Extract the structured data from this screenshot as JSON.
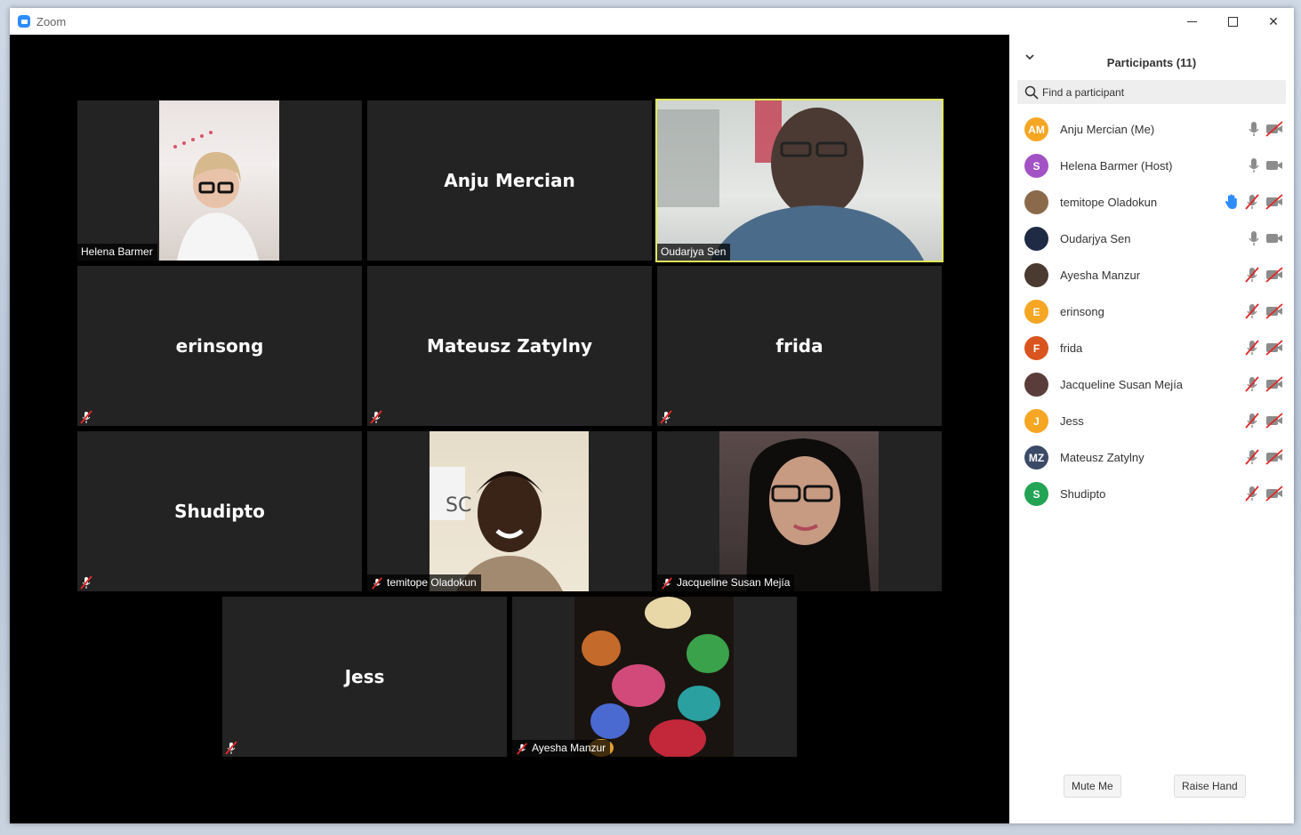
{
  "window": {
    "title": "Zoom"
  },
  "gallery": {
    "tiles": [
      {
        "name": "Helena Barmer",
        "video": true,
        "label_tag": "Helena Barmer",
        "muted": false
      },
      {
        "name": "Anju Mercian",
        "video": false,
        "muted": false
      },
      {
        "name": "Oudarjya Sen",
        "video": true,
        "label_tag": "Oudarjya Sen",
        "muted": false,
        "active_speaker": true
      },
      {
        "name": "erinsong",
        "video": false,
        "muted": true
      },
      {
        "name": "Mateusz Zatylny",
        "video": false,
        "muted": true
      },
      {
        "name": "frida",
        "video": false,
        "muted": true
      },
      {
        "name": "Shudipto",
        "video": false,
        "muted": true
      },
      {
        "name": "temitope Oladokun",
        "video": true,
        "label_tag": "temitope Oladokun",
        "muted": true
      },
      {
        "name": "Jacqueline Susan Mejía",
        "video": true,
        "label_tag": "Jacqueline Susan Mejía",
        "muted": true
      },
      {
        "name": "Jess",
        "video": false,
        "muted": true
      },
      {
        "name": "Ayesha Manzur",
        "video": true,
        "label_tag": "Ayesha Manzur",
        "muted": true
      }
    ]
  },
  "participants": {
    "title": "Participants (11)",
    "search_placeholder": "Find a participant",
    "list": [
      {
        "initials": "AM",
        "name": "Anju Mercian (Me)",
        "color": "#f5a623",
        "mic": "on",
        "cam": "off"
      },
      {
        "initials": "S",
        "name": "Helena Barmer (Host)",
        "color": "#a352c6",
        "mic": "on",
        "cam": "on"
      },
      {
        "initials": "",
        "name": "temitope Oladokun",
        "color": "#8a6a4a",
        "mic": "off",
        "cam": "off",
        "hand": true
      },
      {
        "initials": "",
        "name": "Oudarjya Sen",
        "color": "#1f2a44",
        "mic": "on",
        "cam": "on"
      },
      {
        "initials": "",
        "name": "Ayesha Manzur",
        "color": "#4a3a30",
        "mic": "off",
        "cam": "off"
      },
      {
        "initials": "E",
        "name": "erinsong",
        "color": "#f5a623",
        "mic": "off",
        "cam": "off"
      },
      {
        "initials": "F",
        "name": "frida",
        "color": "#d9541e",
        "mic": "off",
        "cam": "off"
      },
      {
        "initials": "",
        "name": "Jacqueline Susan Mejía",
        "color": "#5a3d3a",
        "mic": "off",
        "cam": "off"
      },
      {
        "initials": "J",
        "name": "Jess",
        "color": "#f5a623",
        "mic": "off",
        "cam": "off"
      },
      {
        "initials": "MZ",
        "name": "Mateusz Zatylny",
        "color": "#3b4a66",
        "mic": "off",
        "cam": "off"
      },
      {
        "initials": "S",
        "name": "Shudipto",
        "color": "#23a455",
        "mic": "off",
        "cam": "off"
      }
    ],
    "mute_me_label": "Mute Me",
    "raise_hand_label": "Raise Hand"
  }
}
